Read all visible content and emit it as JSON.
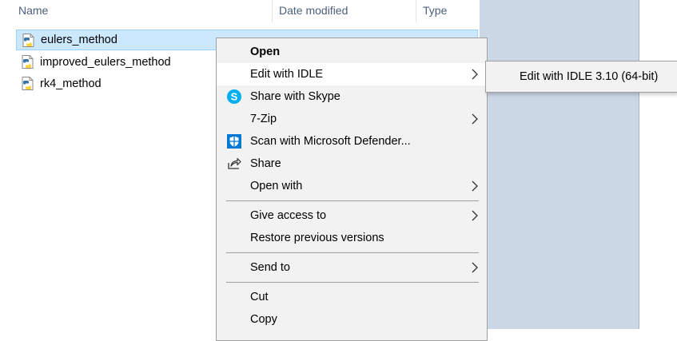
{
  "columns": {
    "name": "Name",
    "date_modified": "Date modified",
    "type": "Type"
  },
  "files": [
    {
      "name": "eulers_method",
      "selected": true
    },
    {
      "name": "improved_eulers_method",
      "selected": false
    },
    {
      "name": "rk4_method",
      "selected": false
    }
  ],
  "context_menu": {
    "open": "Open",
    "edit_with_idle": "Edit with IDLE",
    "share_with_skype": "Share with Skype",
    "seven_zip": "7-Zip",
    "scan_defender": "Scan with Microsoft Defender...",
    "share": "Share",
    "open_with": "Open with",
    "give_access_to": "Give access to",
    "restore_previous_versions": "Restore previous versions",
    "send_to": "Send to",
    "cut": "Cut",
    "copy": "Copy"
  },
  "submenu": {
    "edit_with_idle_310": "Edit with IDLE 3.10 (64-bit)"
  },
  "icons": {
    "python_file": "python-file-icon",
    "skype": "skype-icon",
    "defender": "defender-shield-icon",
    "share": "share-icon",
    "submenu_arrow": "chevron-right-icon"
  },
  "colors": {
    "selection_bg": "#cce8ff",
    "menu_bg": "#f2f2f2",
    "skype_blue": "#00aff0",
    "defender_blue": "#0078d4"
  }
}
